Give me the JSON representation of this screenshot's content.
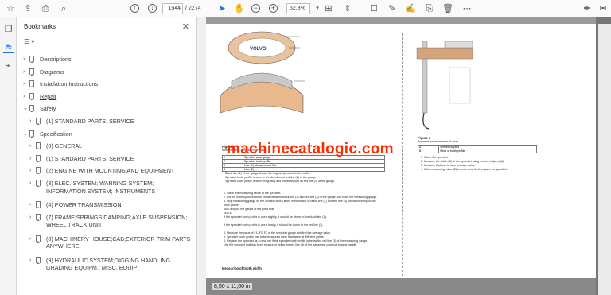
{
  "toolbar": {
    "current_page": "1544",
    "total_pages": "/ 2274",
    "zoom": "52,8%",
    "icons_left": [
      "star-icon",
      "cloud-upload-icon",
      "print-icon",
      "search-icon"
    ],
    "icons_nav": [
      "page-up-icon",
      "page-down-icon"
    ],
    "icons_tools": [
      "select-cursor-icon",
      "hand-icon",
      "zoom-out-icon",
      "zoom-in-icon",
      "dropdown-chevron-icon",
      "fit-page-icon",
      "scroll-mode-icon",
      "comment-icon",
      "pen-icon",
      "highlight-icon",
      "delete-icon",
      "more-icon"
    ],
    "icons_right": [
      "sign-icon",
      "mail-icon"
    ]
  },
  "rail": {
    "icons": [
      "pages-icon",
      "bookmark-icon",
      "attachment-icon"
    ]
  },
  "bookmarks": {
    "title": "Bookmarks",
    "items": [
      {
        "label": "Descriptions",
        "level": 0,
        "expanded": false
      },
      {
        "label": "Diagrams",
        "level": 0,
        "expanded": false
      },
      {
        "label": "Installation Instructions",
        "level": 0,
        "expanded": false
      },
      {
        "label": "Repair",
        "level": 0,
        "expanded": false
      },
      {
        "label": "Safety",
        "level": 0,
        "expanded": true
      },
      {
        "label": "(1) STANDARD PARTS, SERVICE",
        "level": 1,
        "expanded": false
      },
      {
        "label": "Specification",
        "level": 0,
        "expanded": true
      },
      {
        "label": "(0) GENERAL",
        "level": 1,
        "expanded": false
      },
      {
        "label": "(1) STANDARD PARTS, SERVICE",
        "level": 1,
        "expanded": false
      },
      {
        "label": "(2) ENGINE WITH MOUNTING AND EQUIPMENT",
        "level": 1,
        "expanded": false
      },
      {
        "label": "(3) ELEC. SYSTEM; WARNING SYSTEM; INFORMATION SYSTEM; INSTRUMENTS",
        "level": 1,
        "expanded": false
      },
      {
        "label": "(4) POWER TRANSMISSION",
        "level": 1,
        "expanded": false
      },
      {
        "label": "(7) FRAME;SPRINGS;DAMPING;AXLE SUSPENSION; WHEEL TRACK UNIT",
        "level": 1,
        "expanded": false
      },
      {
        "label": "(8) MACHINERY HOUSE;CAB;EXTERIOR TRIM PARTS ANYWHERE",
        "level": 1,
        "expanded": false
      },
      {
        "label": "(9) HYDRAULIC SYSTEM;DIGGING HANDLING GRADING EQUIPM.; MISC. EQUIP",
        "level": 1,
        "expanded": false
      }
    ]
  },
  "document": {
    "watermark": "machinecatalogic.com",
    "figure_left_caption": "Figure 2",
    "figure_left_sub": "Measurement, sprocket tooth wear",
    "figure_right_caption": "Figure 3",
    "figure_right_sub": "Sprocket, measurement of wear",
    "logo_text": "VOLVO",
    "left_table": [
      [
        "1",
        "Sprocket wear gauge"
      ],
      [
        "2",
        "Sprocket tooth profile"
      ],
      [
        "3",
        "Line (1) Measurement line"
      ],
      [
        "4",
        "Line (2) ..."
      ]
    ],
    "right_table": [
      [
        "A",
        "Vernier calipers"
      ],
      [
        "B",
        "Wear of tooth profile"
      ]
    ],
    "left_notes": [
      "Black line (1) of the gauge shows the original sprocket tooth profile.",
      "Sprocket tooth profile is worn in the direction of red line (2) of the gauge.",
      "Sprocket tooth profile is worn irregularly and not as regular as red line (3) of the gauge."
    ],
    "left_steps": [
      "1.   Clean the measuring faces of the sprocket.",
      "2.   Put the worn sprocket tooth profile between black line (1) and red line (3) of the gauge and move the measuring gauge.",
      "3.   Stop measuring gauge on the location which is the most similar to black line (1) and red line (3) formation on sprocket",
      "      tooth profile.",
      "      Stop and put the gauge at the point that",
      "      NOTE!",
      "      If the sprocket tooth profile is worn slightly, it should be closer to the black line (1).",
      "",
      "      If the sprocket tooth profile is worn hardly, it should be closer to the red line (3).",
      "",
      "4.   Measure the value of F1, F2, F3 of the sprocket gauge and find the average value.",
      "5.   Sprocket tooth profile has to be measured more than twice at different points.",
      "6.   Replace the sprocket as a new one if the sprocket tooth profile is below the red line (3) of the measuring gauge.",
      "      Use the sprocket that has been measured below the red line (3) of the gauge will continue to wear rapidly."
    ],
    "left_footer": "Measuring of tooth width",
    "right_steps": [
      "1.   Clean the sprocket.",
      "2.   Measure the width (B) of the sprocket using vernier calipers (A).",
      "3.   Measure 2 places to take average value.",
      "4.   If the measuring value (B) is wear wear limit, replace the sprocket."
    ],
    "page_size": "8,50 x 11,00 in"
  }
}
